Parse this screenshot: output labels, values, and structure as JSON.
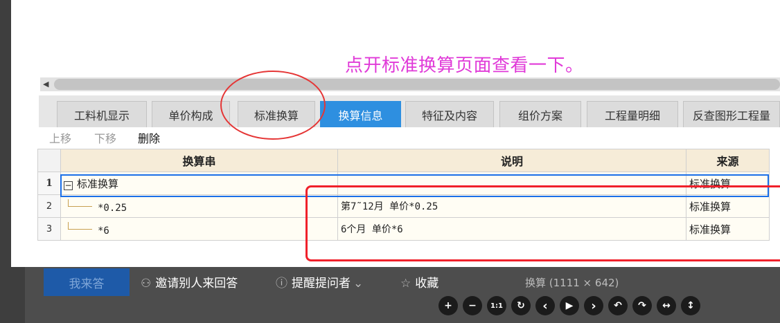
{
  "annotation_text": "点开标准换算页面查看一下。",
  "tabs": [
    {
      "label": "工料机显示"
    },
    {
      "label": "单价构成"
    },
    {
      "label": "标准换算"
    },
    {
      "label": "换算信息",
      "active": true
    },
    {
      "label": "特征及内容"
    },
    {
      "label": "组价方案"
    },
    {
      "label": "工程量明细"
    },
    {
      "label": "反查图形工程量"
    }
  ],
  "toolbar": {
    "move_up": "上移",
    "move_down": "下移",
    "delete": "删除"
  },
  "table": {
    "headers": {
      "formula": "换算串",
      "description": "说明",
      "source": "来源"
    },
    "rows": [
      {
        "num": "1",
        "expander": "−",
        "formula": "标准换算",
        "description": "",
        "source": "标准换算"
      },
      {
        "num": "2",
        "formula": "*0.25",
        "description": "第7˜12月 单价*0.25",
        "source": "标准换算"
      },
      {
        "num": "3",
        "formula": "*6",
        "description": "6个月 单价*6",
        "source": "标准换算"
      }
    ]
  },
  "bottom_bar": {
    "answer_button": "我来答",
    "invite": "邀请别人来回答",
    "remind": "提醒提问者",
    "favorite": "收藏",
    "image_caption": "换算 (1111 × 642)"
  },
  "viewer_controls": [
    {
      "name": "zoom-in-button",
      "glyph": "+"
    },
    {
      "name": "zoom-out-button",
      "glyph": "−"
    },
    {
      "name": "actual-size-button",
      "glyph": "1:1"
    },
    {
      "name": "reset-button",
      "glyph": "↻"
    },
    {
      "name": "prev-button",
      "glyph": "‹"
    },
    {
      "name": "play-button",
      "glyph": "▶"
    },
    {
      "name": "next-button",
      "glyph": "›"
    },
    {
      "name": "rotate-left-button",
      "glyph": "↶"
    },
    {
      "name": "rotate-right-button",
      "glyph": "↷"
    },
    {
      "name": "flip-horizontal-button",
      "glyph": "↔"
    },
    {
      "name": "flip-vertical-button",
      "glyph": "↕"
    }
  ],
  "colors": {
    "annotation": "#e03ad8",
    "active_tab": "#2e8fe0",
    "selection": "#1a6fe8",
    "highlight_red": "#f0202a"
  }
}
